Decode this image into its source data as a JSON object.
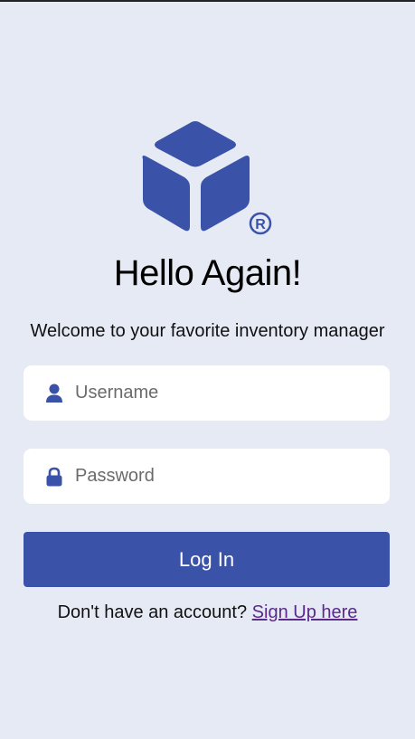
{
  "header": {
    "title": "Hello Again!",
    "subtitle": "Welcome to your favorite inventory manager"
  },
  "logo": {
    "icon": "cube-logo-icon",
    "mark": "®"
  },
  "form": {
    "username_placeholder": "Username",
    "password_placeholder": "Password",
    "username_icon": "user-icon",
    "password_icon": "lock-icon",
    "login_label": "Log In"
  },
  "footer": {
    "prompt": "Don't have an account?",
    "link_label": "Sign Up here"
  },
  "colors": {
    "background": "#e6eaf5",
    "accent": "#3a52a8",
    "link": "#5a2a8a"
  }
}
